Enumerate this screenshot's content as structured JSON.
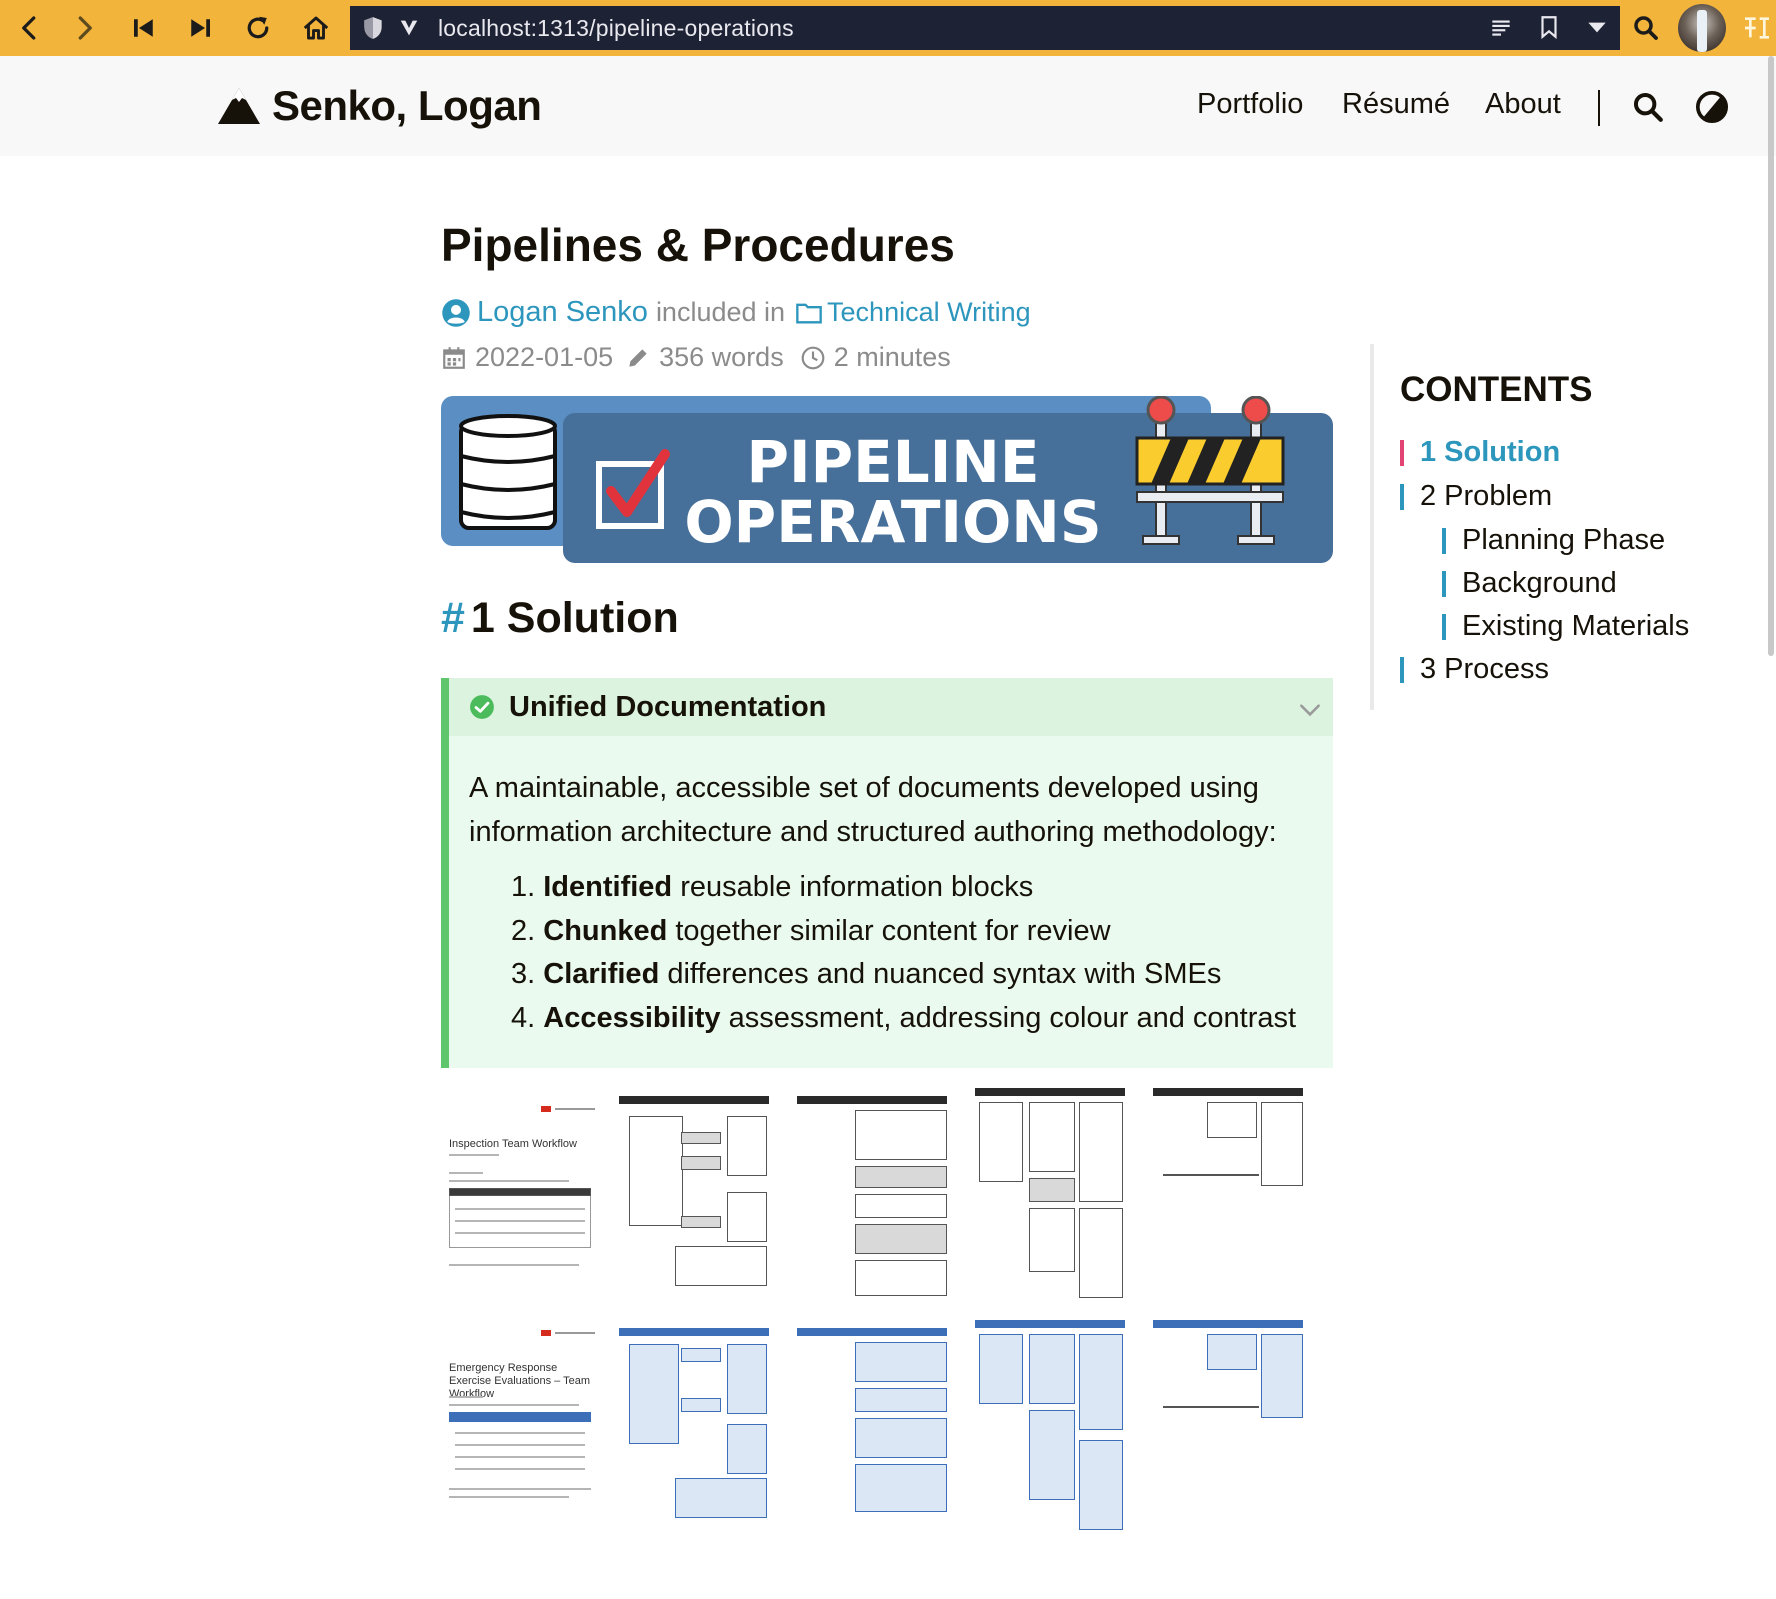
{
  "browser": {
    "url": "localhost:1313/pipeline-operations"
  },
  "header": {
    "brand": "Senko, Logan",
    "menu": [
      "Portfolio",
      "Résumé",
      "About"
    ]
  },
  "article": {
    "title": "Pipelines & Procedures",
    "author": "Logan Senko",
    "included_in": "included in",
    "category": "Technical Writing",
    "date": "2022-01-05",
    "words": "356 words",
    "reading_time": "2 minutes",
    "banner": {
      "line1": "PIPELINE",
      "line2": "OPERATIONS"
    },
    "section1": {
      "hash": "#",
      "title": "1 Solution"
    },
    "admonition": {
      "title": "Unified Documentation",
      "intro": "A maintainable, accessible set of documents developed using information architecture and structured authoring methodology:",
      "items": [
        {
          "num": "1.",
          "bold": "Identified",
          "rest": " reusable information blocks"
        },
        {
          "num": "2.",
          "bold": "Chunked",
          "rest": " together similar content for review"
        },
        {
          "num": "3.",
          "bold": "Clarified",
          "rest": " differences and nuanced syntax with SMEs"
        },
        {
          "num": "4.",
          "bold": "Accessibility",
          "rest": " assessment, addressing colour and contrast"
        }
      ]
    },
    "thumbnails": {
      "row1_title": "Inspection Team Workflow",
      "row2_title": "Emergency Response Exercise Evaluations – Team Workflow"
    }
  },
  "toc": {
    "title": "CONTENTS",
    "items": [
      "1 Solution",
      "2 Problem",
      "Planning Phase",
      "Background",
      "Existing Materials",
      "3 Process"
    ]
  },
  "colors": {
    "browser_bar": "#f2b43a",
    "accent": "#2d96bd",
    "toc_active_marker": "#e14472",
    "admonition_border": "#5fc66c",
    "banner_blue": "#46709a"
  }
}
